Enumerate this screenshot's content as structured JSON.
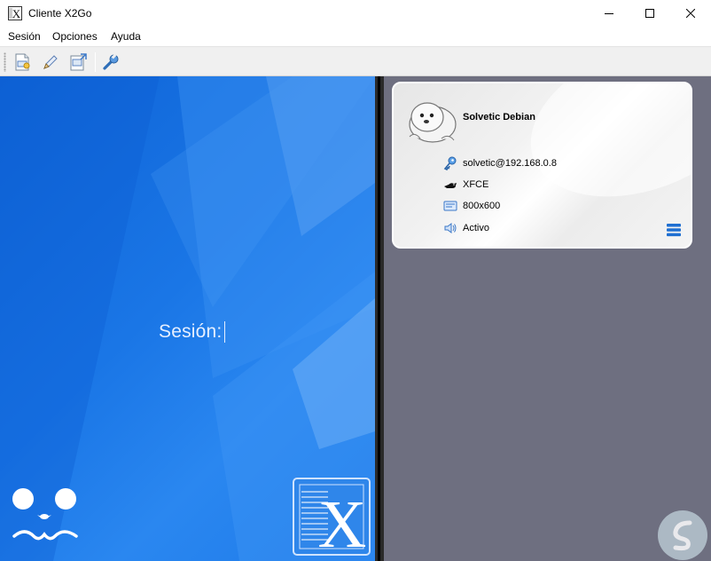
{
  "window": {
    "title": "Cliente X2Go"
  },
  "menu": {
    "items": [
      "Sesión",
      "Opciones",
      "Ayuda"
    ]
  },
  "toolbar": {
    "icons": [
      "new-session-icon",
      "edit-session-icon",
      "export-session-icon",
      "settings-wrench-icon"
    ]
  },
  "login": {
    "session_label": "Sesión:",
    "session_value": ""
  },
  "session_card": {
    "name": "Solvetic Debian",
    "user_host": "solvetic@192.168.0.8",
    "desktop": "XFCE",
    "resolution": "800x600",
    "status": "Activo"
  },
  "colors": {
    "left_bg": "#1a76e6",
    "right_bg": "#6e6f80",
    "accent_blue": "#1f6fd1"
  }
}
